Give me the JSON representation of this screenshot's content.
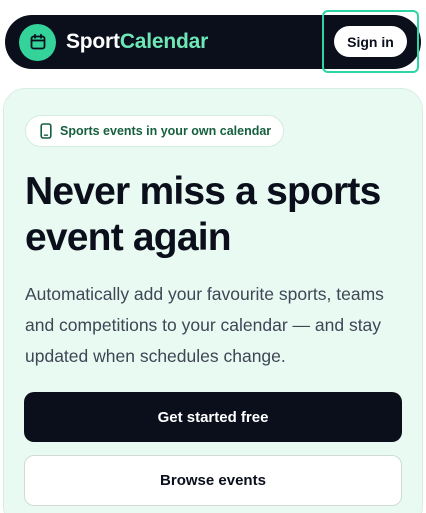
{
  "nav": {
    "brand_part1": "Sport",
    "brand_part2": "Calendar",
    "logo_icon": "calendar-icon",
    "signin_label": "Sign in"
  },
  "hero": {
    "pill_icon": "phone-icon",
    "pill_text": "Sports events in your own calendar",
    "headline": "Never miss a sports event again",
    "subtext": "Automatically add your favourite sports, teams and competitions to your calendar — and stay updated when schedules change.",
    "primary_cta": "Get started free",
    "secondary_cta": "Browse events"
  },
  "colors": {
    "nav_bg": "#0b0f1c",
    "accent": "#34d399",
    "brand_accent_text": "#6ee7b7",
    "hero_bg": "#e8faf1",
    "focus_ring": "#2dd4a4"
  }
}
